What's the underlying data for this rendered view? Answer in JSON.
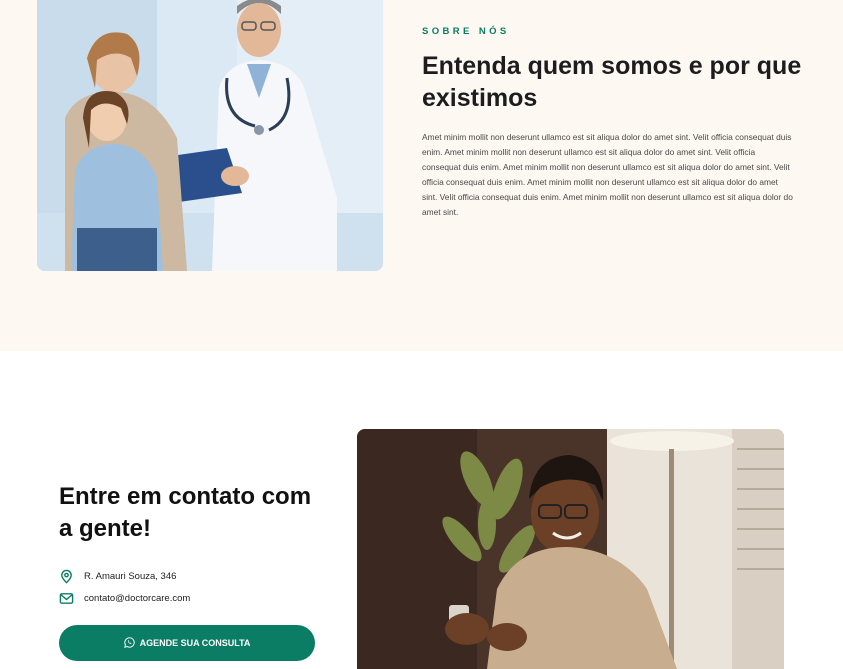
{
  "about": {
    "kicker": "SOBRE NÓS",
    "title": "Entenda quem somos e por que existimos",
    "text": "Amet minim mollit non deserunt ullamco est sit aliqua dolor do amet sint. Velit officia consequat duis enim. Amet minim mollit non deserunt ullamco est sit aliqua dolor do amet sint. Velit officia consequat duis enim. Amet minim mollit non deserunt ullamco est sit aliqua dolor do amet sint. Velit officia consequat duis enim. Amet minim mollit non deserunt ullamco est sit aliqua dolor do amet sint. Velit officia consequat duis enim. Amet minim mollit non deserunt ullamco est sit aliqua dolor do amet sint.",
    "photo": "doctor-with-mother-and-child-photo"
  },
  "contact": {
    "title": "Entre em contato com a gente!",
    "address": "R. Amauri Souza, 346",
    "email": "contato@doctorcare.com",
    "address_icon": "map-pin-icon",
    "email_icon": "mail-icon",
    "cta_label": "AGENDE SUA CONSULTA",
    "cta_icon": "whatsapp-icon",
    "photo": "man-using-phone-photo"
  },
  "colors": {
    "accent": "#0b7d65",
    "about_bg": "#fdf8f1",
    "text_dark": "#1d1d1f"
  }
}
